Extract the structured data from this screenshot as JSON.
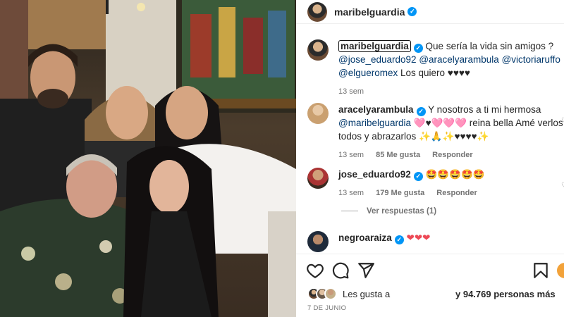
{
  "post": {
    "username": "maribelguardia",
    "verified_mark": "✓",
    "caption_text": "Que sería la vida sin amigos ?",
    "caption_mentions": [
      "@jose_eduardo92",
      "@aracelyarambula",
      "@victoriaruffo",
      "@elgueromex"
    ],
    "caption_tail": "Los quiero ♥♥♥♥",
    "caption_time": "13 sem"
  },
  "comments": [
    {
      "username": "aracelyarambula",
      "text_pre": "Y nosotros a ti mi hermosa",
      "mention": "@maribelguardia",
      "text_post": "🩷♥🩷🩷🩷 reina bella Amé verlos a todos y abrazarlos ✨🙏✨♥♥♥♥✨",
      "time": "13 sem",
      "likes": "85 Me gusta",
      "reply": "Responder"
    },
    {
      "username": "jose_eduardo92",
      "text": "🤩🤩🤩🤩🤩",
      "time": "13 sem",
      "likes": "179 Me gusta",
      "reply": "Responder",
      "view_replies": "Ver respuestas (1)"
    },
    {
      "username": "negroaraiza",
      "text": "❤❤❤"
    }
  ],
  "footer": {
    "liked_by_label": "Les gusta a",
    "liked_count": "y 94.769 personas más",
    "date": "7 DE JUNIO"
  },
  "icons": [
    "heart-icon",
    "comment-icon",
    "share-icon",
    "save-icon"
  ],
  "colors": {
    "accent": "#0095f6",
    "mention": "#00376b",
    "heart": "#ed4956"
  }
}
